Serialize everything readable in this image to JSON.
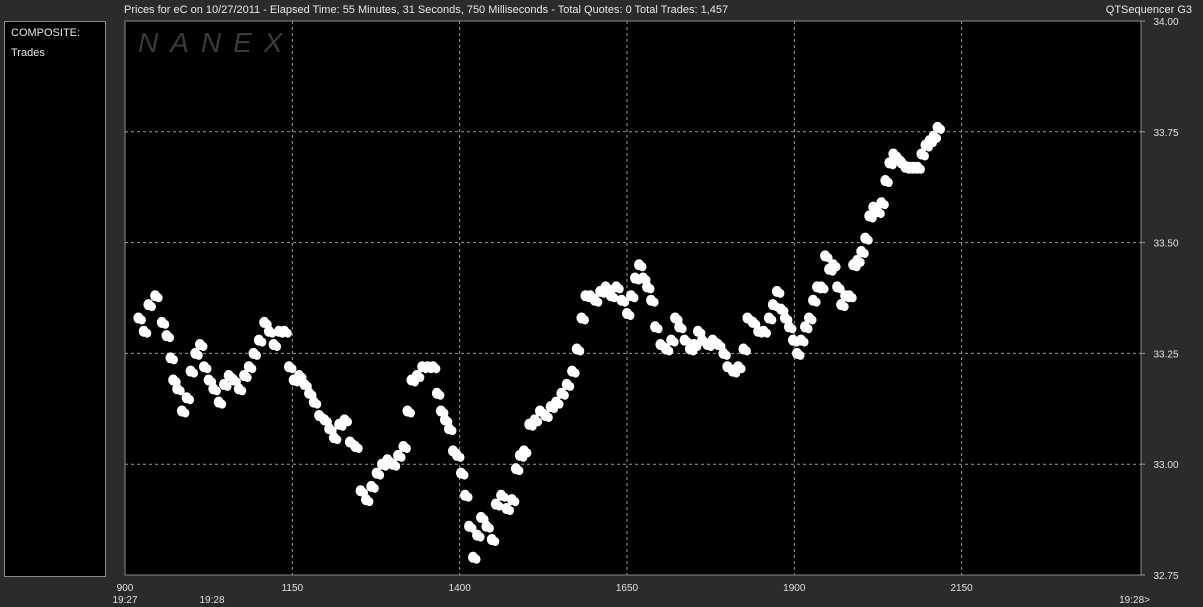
{
  "title": {
    "left": "Prices for  eC  on  10/27/2011  -  Elapsed Time: 55 Minutes, 31 Seconds, 750 Milliseconds  -  Total Quotes: 0  Total Trades: 1,457",
    "right": "QTSequencer G3"
  },
  "side_panel": {
    "header": "COMPOSITE:",
    "label": "Trades"
  },
  "watermark": "NANEX",
  "chart_data": {
    "type": "scatter",
    "title": "Prices for  eC  on  10/27/2011",
    "xlabel": "",
    "ylabel": "",
    "xlim": [
      900,
      2418
    ],
    "ylim": [
      32.75,
      34.0
    ],
    "y_ticks": [
      "32.75",
      "33.00",
      "33.25",
      "33.50",
      "33.75",
      "34.00"
    ],
    "x_ticks": [
      {
        "value": 900,
        "label": "900"
      },
      {
        "value": 1150,
        "label": "1150"
      },
      {
        "value": 1400,
        "label": "1400"
      },
      {
        "value": 1650,
        "label": "1650"
      },
      {
        "value": 1900,
        "label": "1900"
      },
      {
        "value": 2150,
        "label": "2150"
      }
    ],
    "time_labels": [
      {
        "value": 900,
        "label": "19:27"
      },
      {
        "value": 1030,
        "label": "19:28"
      },
      {
        "value": 2418,
        "label": "19:28>"
      }
    ],
    "grid": true,
    "marker_color": "#ffffff",
    "background": "#000000",
    "series": [
      {
        "points": [
          [
            920,
            33.33
          ],
          [
            928,
            33.3
          ],
          [
            935,
            33.36
          ],
          [
            945,
            33.38
          ],
          [
            955,
            33.32
          ],
          [
            962,
            33.29
          ],
          [
            968,
            33.24
          ],
          [
            972,
            33.19
          ],
          [
            978,
            33.17
          ],
          [
            985,
            33.12
          ],
          [
            992,
            33.15
          ],
          [
            998,
            33.21
          ],
          [
            1005,
            33.25
          ],
          [
            1012,
            33.27
          ],
          [
            1018,
            33.22
          ],
          [
            1025,
            33.19
          ],
          [
            1032,
            33.17
          ],
          [
            1040,
            33.14
          ],
          [
            1048,
            33.18
          ],
          [
            1055,
            33.2
          ],
          [
            1062,
            33.19
          ],
          [
            1070,
            33.17
          ],
          [
            1078,
            33.2
          ],
          [
            1085,
            33.22
          ],
          [
            1092,
            33.25
          ],
          [
            1100,
            33.28
          ],
          [
            1108,
            33.32
          ],
          [
            1115,
            33.3
          ],
          [
            1122,
            33.27
          ],
          [
            1130,
            33.3
          ],
          [
            1138,
            33.3
          ],
          [
            1145,
            33.22
          ],
          [
            1152,
            33.19
          ],
          [
            1160,
            33.2
          ],
          [
            1168,
            33.18
          ],
          [
            1175,
            33.16
          ],
          [
            1182,
            33.14
          ],
          [
            1190,
            33.11
          ],
          [
            1198,
            33.1
          ],
          [
            1205,
            33.08
          ],
          [
            1212,
            33.06
          ],
          [
            1220,
            33.09
          ],
          [
            1228,
            33.1
          ],
          [
            1236,
            33.05
          ],
          [
            1244,
            33.04
          ],
          [
            1252,
            32.94
          ],
          [
            1260,
            32.92
          ],
          [
            1268,
            32.95
          ],
          [
            1276,
            32.98
          ],
          [
            1284,
            33.0
          ],
          [
            1292,
            33.01
          ],
          [
            1300,
            33.0
          ],
          [
            1308,
            33.02
          ],
          [
            1316,
            33.04
          ],
          [
            1322,
            33.12
          ],
          [
            1328,
            33.19
          ],
          [
            1336,
            33.2
          ],
          [
            1344,
            33.22
          ],
          [
            1352,
            33.22
          ],
          [
            1360,
            33.22
          ],
          [
            1366,
            33.16
          ],
          [
            1372,
            33.12
          ],
          [
            1378,
            33.1
          ],
          [
            1384,
            33.08
          ],
          [
            1390,
            33.03
          ],
          [
            1396,
            33.02
          ],
          [
            1402,
            32.98
          ],
          [
            1408,
            32.93
          ],
          [
            1414,
            32.86
          ],
          [
            1420,
            32.79
          ],
          [
            1426,
            32.84
          ],
          [
            1432,
            32.88
          ],
          [
            1440,
            32.86
          ],
          [
            1448,
            32.83
          ],
          [
            1454,
            32.91
          ],
          [
            1462,
            32.93
          ],
          [
            1470,
            32.9
          ],
          [
            1478,
            32.92
          ],
          [
            1484,
            32.99
          ],
          [
            1490,
            33.02
          ],
          [
            1496,
            33.03
          ],
          [
            1504,
            33.09
          ],
          [
            1512,
            33.1
          ],
          [
            1520,
            33.12
          ],
          [
            1528,
            33.11
          ],
          [
            1536,
            33.13
          ],
          [
            1544,
            33.14
          ],
          [
            1552,
            33.16
          ],
          [
            1560,
            33.18
          ],
          [
            1568,
            33.21
          ],
          [
            1575,
            33.26
          ],
          [
            1582,
            33.33
          ],
          [
            1588,
            33.38
          ],
          [
            1595,
            33.38
          ],
          [
            1602,
            33.37
          ],
          [
            1610,
            33.39
          ],
          [
            1618,
            33.4
          ],
          [
            1626,
            33.38
          ],
          [
            1634,
            33.4
          ],
          [
            1642,
            33.37
          ],
          [
            1650,
            33.34
          ],
          [
            1656,
            33.38
          ],
          [
            1662,
            33.42
          ],
          [
            1668,
            33.45
          ],
          [
            1674,
            33.42
          ],
          [
            1680,
            33.4
          ],
          [
            1686,
            33.37
          ],
          [
            1692,
            33.31
          ],
          [
            1700,
            33.27
          ],
          [
            1708,
            33.26
          ],
          [
            1716,
            33.28
          ],
          [
            1722,
            33.33
          ],
          [
            1728,
            33.31
          ],
          [
            1736,
            33.28
          ],
          [
            1744,
            33.26
          ],
          [
            1750,
            33.27
          ],
          [
            1756,
            33.3
          ],
          [
            1762,
            33.28
          ],
          [
            1770,
            33.27
          ],
          [
            1778,
            33.28
          ],
          [
            1786,
            33.27
          ],
          [
            1794,
            33.25
          ],
          [
            1800,
            33.22
          ],
          [
            1808,
            33.21
          ],
          [
            1816,
            33.22
          ],
          [
            1824,
            33.26
          ],
          [
            1830,
            33.33
          ],
          [
            1838,
            33.32
          ],
          [
            1846,
            33.3
          ],
          [
            1854,
            33.3
          ],
          [
            1862,
            33.33
          ],
          [
            1868,
            33.36
          ],
          [
            1874,
            33.39
          ],
          [
            1880,
            33.35
          ],
          [
            1886,
            33.33
          ],
          [
            1892,
            33.31
          ],
          [
            1898,
            33.28
          ],
          [
            1904,
            33.25
          ],
          [
            1910,
            33.28
          ],
          [
            1916,
            33.31
          ],
          [
            1922,
            33.33
          ],
          [
            1928,
            33.37
          ],
          [
            1934,
            33.4
          ],
          [
            1940,
            33.4
          ],
          [
            1946,
            33.47
          ],
          [
            1952,
            33.44
          ],
          [
            1958,
            33.45
          ],
          [
            1964,
            33.4
          ],
          [
            1970,
            33.36
          ],
          [
            1976,
            33.38
          ],
          [
            1982,
            33.38
          ],
          [
            1988,
            33.45
          ],
          [
            1994,
            33.46
          ],
          [
            2000,
            33.48
          ],
          [
            2006,
            33.51
          ],
          [
            2012,
            33.56
          ],
          [
            2018,
            33.58
          ],
          [
            2024,
            33.57
          ],
          [
            2030,
            33.59
          ],
          [
            2036,
            33.64
          ],
          [
            2042,
            33.68
          ],
          [
            2048,
            33.7
          ],
          [
            2054,
            33.69
          ],
          [
            2060,
            33.68
          ],
          [
            2066,
            33.67
          ],
          [
            2072,
            33.67
          ],
          [
            2078,
            33.67
          ],
          [
            2084,
            33.67
          ],
          [
            2090,
            33.7
          ],
          [
            2096,
            33.72
          ],
          [
            2102,
            33.73
          ],
          [
            2108,
            33.74
          ],
          [
            2114,
            33.76
          ]
        ]
      }
    ]
  }
}
